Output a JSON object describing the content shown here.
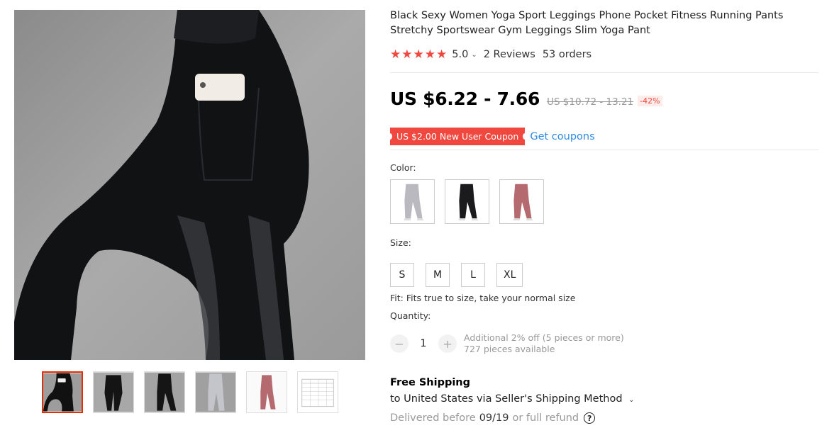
{
  "product": {
    "title": "Black Sexy Women Yoga Sport Leggings Phone Pocket Fitness Running Pants Stretchy Sportswear Gym Leggings Slim Yoga Pant",
    "rating": "5.0",
    "rating_stars": 5,
    "reviews": "2 Reviews",
    "orders": "53 orders"
  },
  "price": {
    "current": "US $6.22 - 7.66",
    "original": "US $10.72 - 13.21",
    "discount": "-42%"
  },
  "coupon": {
    "label": "US $2.00 New User Coupon",
    "link": "Get coupons"
  },
  "color": {
    "label": "Color:",
    "options": [
      {
        "name": "gray-leggings",
        "color": "#b9b9bf"
      },
      {
        "name": "black-leggings",
        "color": "#1b1b1d"
      },
      {
        "name": "pink-leggings",
        "color": "#b56a6f"
      }
    ]
  },
  "size": {
    "label": "Size:",
    "options": [
      "S",
      "M",
      "L",
      "XL"
    ]
  },
  "fit": "Fit: Fits true to size, take your normal size",
  "quantity": {
    "label": "Quantity:",
    "value": "1",
    "minus": "−",
    "plus": "+",
    "discount_note": "Additional 2% off (5 pieces or more)",
    "available": "727 pieces available"
  },
  "shipping": {
    "title": "Free Shipping",
    "destination": "to United States via Seller's Shipping Method",
    "delivery_prefix": "Delivered before",
    "delivery_date": "09/19",
    "delivery_suffix": "or full refund",
    "help_icon": "?"
  },
  "gallery": {
    "thumbnails": [
      "black-leggings-pocket",
      "black-leggings-back",
      "black-leggings-side",
      "gray-leggings",
      "pink-leggings",
      "size-chart"
    ],
    "active_index": 0
  },
  "icons": {
    "star": "★",
    "chevron": "⌄"
  },
  "colors": {
    "accent": "#f0483e",
    "link": "#2e8ae6"
  }
}
